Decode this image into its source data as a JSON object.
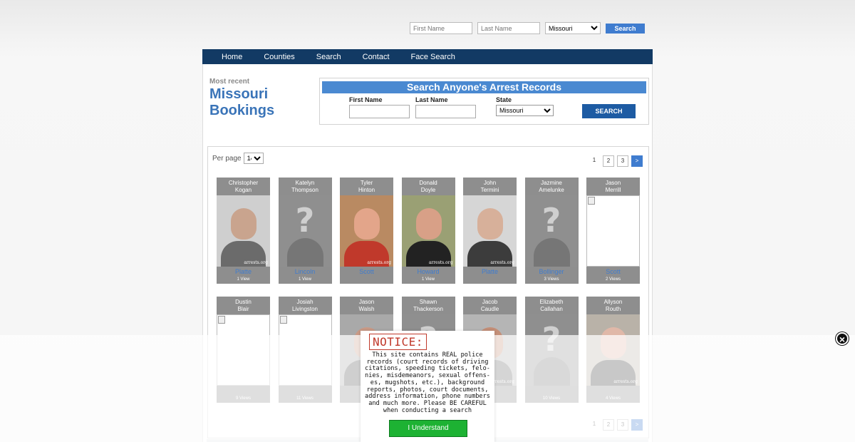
{
  "top_search": {
    "first_placeholder": "First Name",
    "last_placeholder": "Last Name",
    "state": "Missouri",
    "button": "Search"
  },
  "nav": [
    "Home",
    "Counties",
    "Search",
    "Contact",
    "Face Search"
  ],
  "header": {
    "subtitle": "Most recent",
    "title": "Missouri Bookings"
  },
  "search_form": {
    "heading": "Search Anyone's Arrest Records",
    "first_label": "First Name",
    "last_label": "Last Name",
    "state_label": "State",
    "state_value": "Missouri",
    "button": "SEARCH"
  },
  "listing": {
    "per_page_label": "Per page",
    "per_page_value": "14",
    "pages": [
      "1",
      "2",
      "3",
      ">"
    ]
  },
  "cards": [
    {
      "first": "Christopher",
      "last": "Kogan",
      "county": "Platte",
      "views": "1 View",
      "photo": "mugshot",
      "skin": "#c9a48e",
      "shirt": "#6b6b6b",
      "bg": "#cfcfcf"
    },
    {
      "first": "Katelyn",
      "last": "Thompson",
      "county": "Lincoln",
      "views": "1 View",
      "photo": "placeholder"
    },
    {
      "first": "Tyler",
      "last": "Hinton",
      "county": "Scott",
      "views": "",
      "photo": "mugshot",
      "skin": "#e3a58a",
      "shirt": "#c0392b",
      "bg": "#b98a62"
    },
    {
      "first": "Donald",
      "last": "Doyle",
      "county": "Howard",
      "views": "1 View",
      "photo": "mugshot",
      "skin": "#d8a087",
      "shirt": "#222",
      "bg": "#9aa074"
    },
    {
      "first": "John",
      "last": "Termini",
      "county": "Platte",
      "views": "",
      "photo": "mugshot",
      "skin": "#d7b09a",
      "shirt": "#3c3c3c",
      "bg": "#d6d6d6"
    },
    {
      "first": "Jazmine",
      "last": "Amelunke",
      "county": "Bollinger",
      "views": "3 Views",
      "photo": "placeholder"
    },
    {
      "first": "Jason",
      "last": "Merrill",
      "county": "Scott",
      "views": "2 Views",
      "photo": "broken"
    },
    {
      "first": "Dustin",
      "last": "Blair",
      "county": "",
      "views": "9 Views",
      "photo": "broken"
    },
    {
      "first": "Josiah",
      "last": "Livingston",
      "county": "",
      "views": "11 Views",
      "photo": "broken"
    },
    {
      "first": "Jason",
      "last": "Walsh",
      "county": "",
      "views": "",
      "photo": "mugshot",
      "skin": "#c99a86",
      "shirt": "#555",
      "bg": "#a9a9a9"
    },
    {
      "first": "Shawn",
      "last": "Thackerson",
      "county": "",
      "views": "",
      "photo": "placeholder"
    },
    {
      "first": "Jacob",
      "last": "Caudle",
      "county": "",
      "views": "",
      "photo": "mugshot",
      "skin": "#c48f78",
      "shirt": "#6a6a6a",
      "bg": "#b5b5b5"
    },
    {
      "first": "Elizabeth",
      "last": "Callahan",
      "county": "",
      "views": "10 Views",
      "photo": "placeholder"
    },
    {
      "first": "Allyson",
      "last": "Routh",
      "county": "",
      "views": "4 Views",
      "photo": "mugshot",
      "skin": "#e0b8a8",
      "shirt": "#3a3a3a",
      "bg": "#b9b2a8"
    }
  ],
  "photo_watermark": "arrests.org",
  "notice": {
    "title": "NOTICE:",
    "body": "This site contains REAL police\nrecords (court records of driving\ncitations, speeding tickets, felo-\nnies, misdemeanors, sexual offens-\nes, mugshots, etc.), background\nreports, photos, court documents,\naddress information, phone numbers\nand much more. Please BE CAREFUL\nwhen conducting a search",
    "button": "I Understand"
  },
  "icons": {
    "close": "close-icon",
    "placeholder": "question-mark-icon"
  }
}
